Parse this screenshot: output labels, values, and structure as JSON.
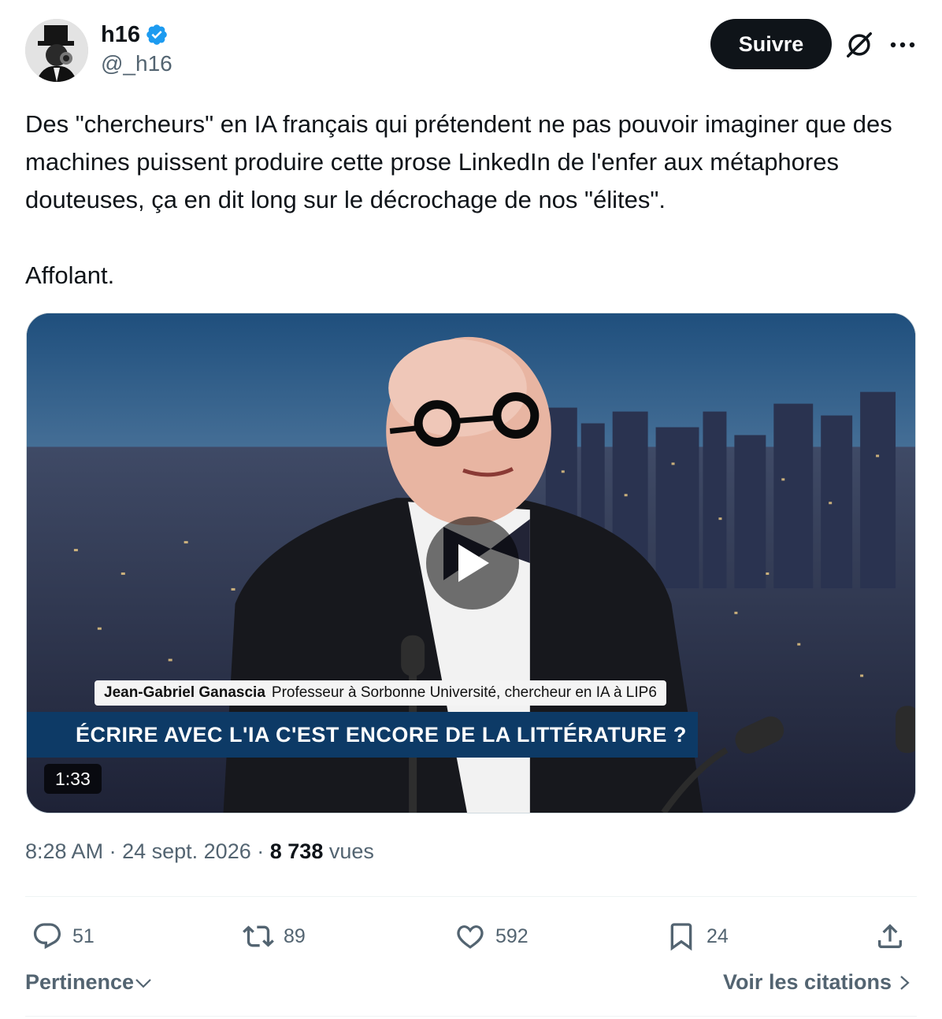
{
  "author": {
    "display_name": "h16",
    "handle": "@_h16",
    "verified": true
  },
  "header": {
    "follow_label": "Suivre",
    "icons": [
      "grok-icon",
      "more-icon"
    ]
  },
  "tweet": {
    "paragraphs": [
      "Des \"chercheurs\" en IA français qui prétendent ne pas pouvoir imaginer que des machines puissent produire cette prose LinkedIn de l'enfer aux métaphores douteuses, ça en dit long sur le décrochage de nos \"élites\".",
      "Affolant."
    ]
  },
  "media": {
    "lower_third_name": "Jean-Gabriel Ganascia",
    "lower_third_title": "Professeur à Sorbonne Université, chercheur en IA à LIP6",
    "banner": "ÉCRIRE AVEC L'IA C'EST ENCORE DE LA LITTÉRATURE ?",
    "duration": "1:33"
  },
  "meta": {
    "time": "8:28 AM",
    "separator": "·",
    "date": "24 sept. 2026",
    "views_count": "8 738",
    "views_label": "vues"
  },
  "actions": {
    "replies": "51",
    "reposts": "89",
    "likes": "592",
    "bookmarks": "24"
  },
  "footer": {
    "sort_label": "Pertinence",
    "quotes_label": "Voir les citations"
  },
  "colors": {
    "text": "#0f1419",
    "secondary": "#536471",
    "verified": "#1d9bf0",
    "banner": "#0d3a66"
  }
}
